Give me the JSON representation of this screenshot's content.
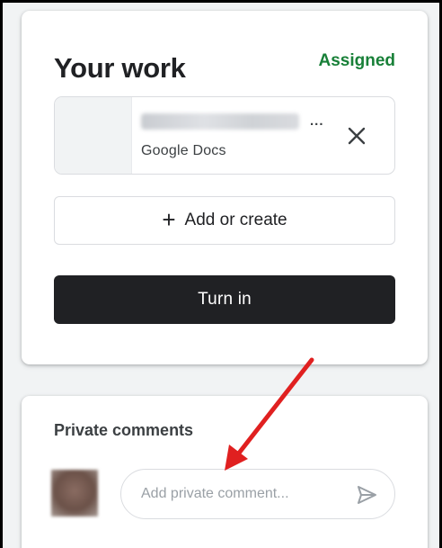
{
  "work": {
    "title": "Your work",
    "status": "Assigned",
    "attachment": {
      "name_ellipsis": "...",
      "subtitle": "Google Docs",
      "remove_icon": "close-icon"
    },
    "add_button": {
      "icon": "plus-icon",
      "label": "Add or create"
    },
    "turn_in_label": "Turn in"
  },
  "comments": {
    "title": "Private comments",
    "placeholder": "Add private comment...",
    "send_icon": "send-icon"
  },
  "colors": {
    "status": "#188038",
    "turn_in_bg": "#202124",
    "annotation_arrow": "#e02020"
  }
}
